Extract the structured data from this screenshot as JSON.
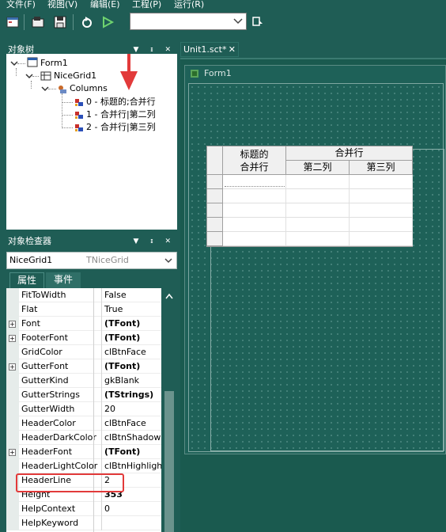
{
  "menu": {
    "items": [
      "文件(F)",
      "视图(V)",
      "编辑(E)",
      "工程(P)",
      "运行(R)"
    ]
  },
  "toolbar": {
    "buttons": [
      "form-icon",
      "open-icon",
      "save-icon",
      "refresh-icon",
      "run-icon"
    ],
    "combo_value": "",
    "pin_button": "pin-icon"
  },
  "object_tree": {
    "title": "对象树",
    "nodes": [
      {
        "label": "Form1",
        "level": 0,
        "icon": "form-icon"
      },
      {
        "label": "NiceGrid1",
        "level": 1,
        "icon": "grid-icon"
      },
      {
        "label": "Columns",
        "level": 2,
        "icon": "columns-icon"
      },
      {
        "label": "0 - 标题的;合并行",
        "level": 3,
        "icon": "column-item-icon"
      },
      {
        "label": "1 - 合并行|第二列",
        "level": 3,
        "icon": "column-item-icon"
      },
      {
        "label": "2 - 合并行|第三列",
        "level": 3,
        "icon": "column-item-icon"
      }
    ]
  },
  "inspector": {
    "title": "对象检查器",
    "component_name": "NiceGrid1",
    "component_type": "TNiceGrid",
    "tabs": [
      "属性",
      "事件"
    ],
    "properties": [
      {
        "name": "FitToWidth",
        "value": "False",
        "expandable": false,
        "bold": false
      },
      {
        "name": "Flat",
        "value": "True",
        "expandable": false,
        "bold": false
      },
      {
        "name": "Font",
        "value": "(TFont)",
        "expandable": true,
        "bold": true
      },
      {
        "name": "FooterFont",
        "value": "(TFont)",
        "expandable": true,
        "bold": true
      },
      {
        "name": "GridColor",
        "value": "clBtnFace",
        "expandable": false,
        "bold": false
      },
      {
        "name": "GutterFont",
        "value": "(TFont)",
        "expandable": true,
        "bold": true
      },
      {
        "name": "GutterKind",
        "value": "gkBlank",
        "expandable": false,
        "bold": false
      },
      {
        "name": "GutterStrings",
        "value": "(TStrings)",
        "expandable": false,
        "bold": true
      },
      {
        "name": "GutterWidth",
        "value": "20",
        "expandable": false,
        "bold": false
      },
      {
        "name": "HeaderColor",
        "value": "clBtnFace",
        "expandable": false,
        "bold": false
      },
      {
        "name": "HeaderDarkColor",
        "value": "clBtnShadow",
        "expandable": false,
        "bold": false
      },
      {
        "name": "HeaderFont",
        "value": "(TFont)",
        "expandable": true,
        "bold": true
      },
      {
        "name": "HeaderLightColor",
        "value": "clBtnHighlight",
        "expandable": false,
        "bold": false
      },
      {
        "name": "HeaderLine",
        "value": "2",
        "expandable": false,
        "bold": false
      },
      {
        "name": "Height",
        "value": "353",
        "expandable": false,
        "bold": true
      },
      {
        "name": "HelpContext",
        "value": "0",
        "expandable": false,
        "bold": false
      },
      {
        "name": "HelpKeyword",
        "value": "",
        "expandable": false,
        "bold": false
      }
    ],
    "highlighted_property": "HeaderLine"
  },
  "document": {
    "tab_label": "Unit1.sct*",
    "form_title": "Form1"
  },
  "nicegrid": {
    "header_top": [
      "标题的\n合并行",
      "合并行"
    ],
    "header_sub": [
      "第二列",
      "第三列"
    ],
    "row_count": 5
  },
  "colors": {
    "ide_background": "#1f5d55",
    "highlight_border": "#e23a3a",
    "arrow": "#e23a3a"
  }
}
